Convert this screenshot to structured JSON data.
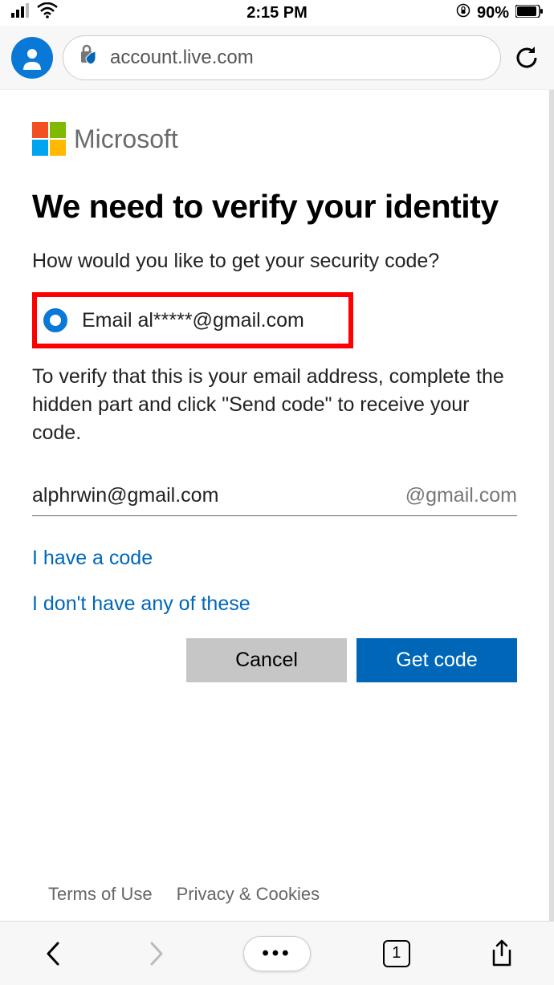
{
  "status_bar": {
    "time": "2:15 PM",
    "battery": "90%"
  },
  "browser": {
    "url": "account.live.com"
  },
  "page": {
    "brand": "Microsoft",
    "heading": "We need to verify your identity",
    "subtitle": "How would you like to get your security code?",
    "radio_option": "Email al*****@gmail.com",
    "instruction": "To verify that this is your email address, complete the hidden part and click \"Send code\" to receive your code.",
    "email_value": "alphrwin@gmail.com",
    "email_suffix": "@gmail.com",
    "link_have_code": "I have a code",
    "link_none": "I don't have any of these",
    "btn_cancel": "Cancel",
    "btn_primary": "Get code"
  },
  "footer": {
    "terms": "Terms of Use",
    "privacy": "Privacy & Cookies"
  },
  "bottom_nav": {
    "tab_count": "1"
  }
}
